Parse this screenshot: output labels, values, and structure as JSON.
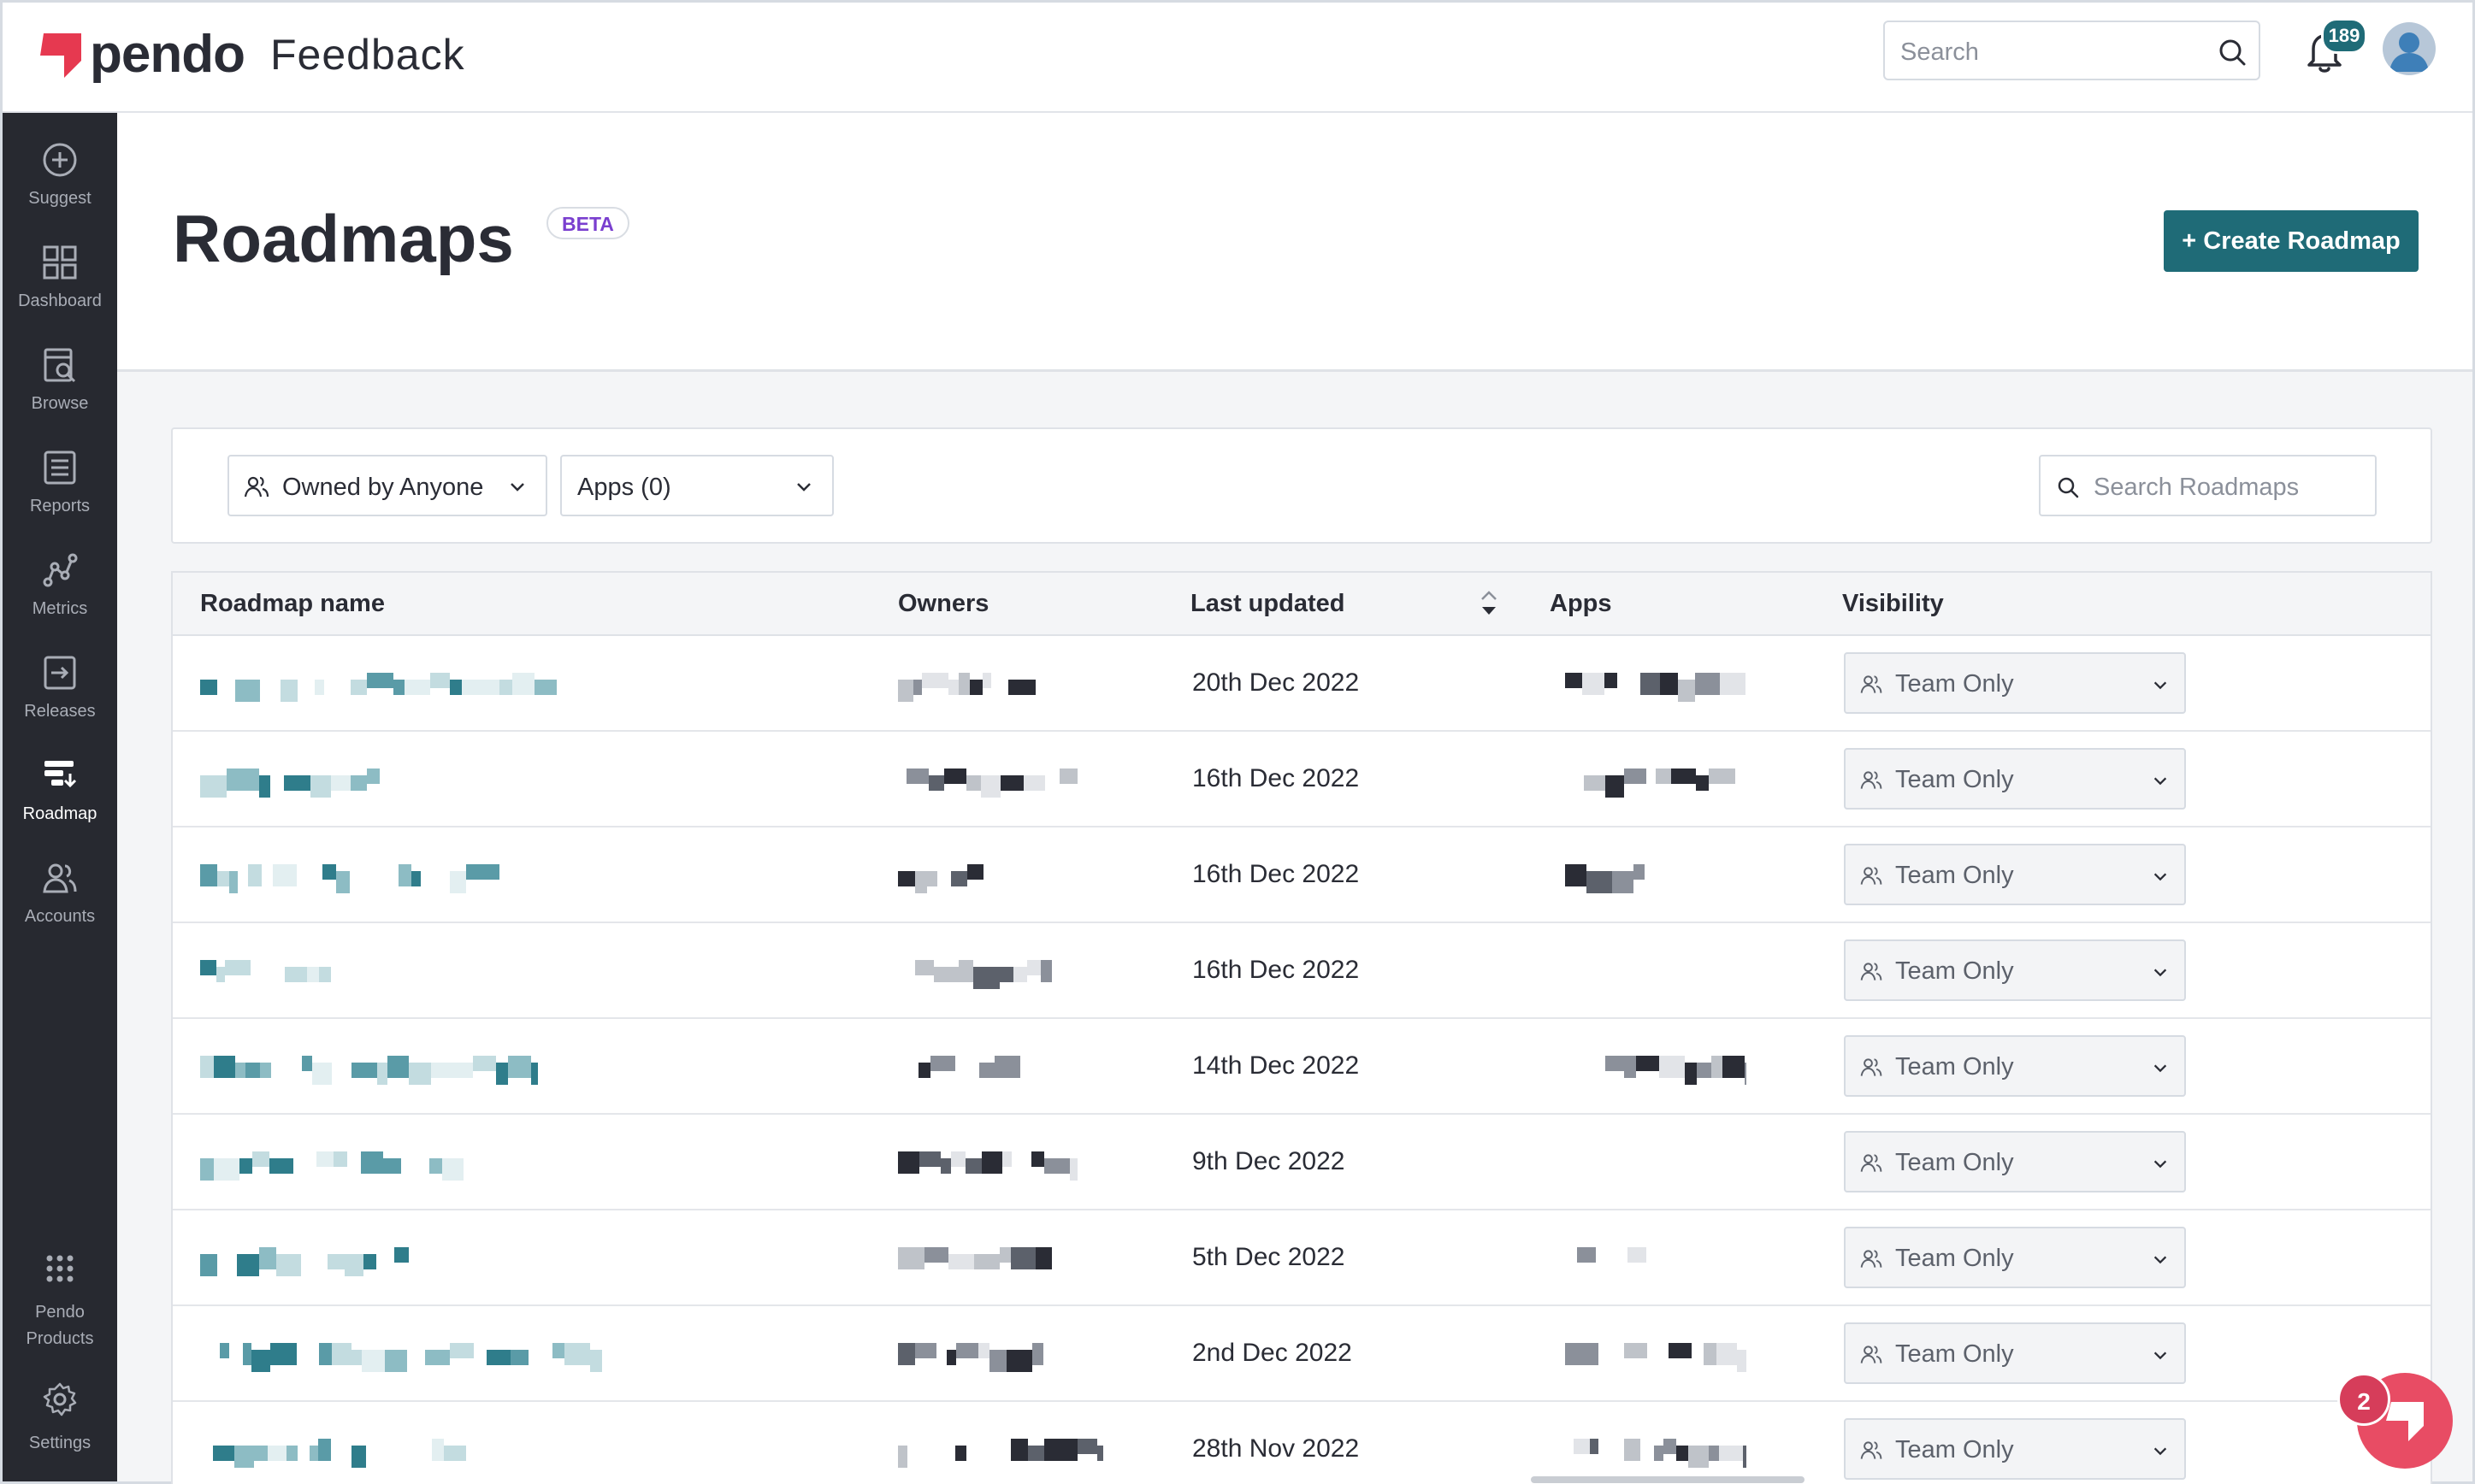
{
  "app": {
    "brand": "pendo",
    "product": "Feedback",
    "accent": "#1f6b77",
    "brand_red": "#e63950"
  },
  "header": {
    "search_placeholder": "Search",
    "notification_count": "189"
  },
  "sidebar": {
    "items": [
      {
        "label": "Suggest",
        "icon": "plus-circle-icon"
      },
      {
        "label": "Dashboard",
        "icon": "grid-icon"
      },
      {
        "label": "Browse",
        "icon": "browse-icon"
      },
      {
        "label": "Reports",
        "icon": "list-icon"
      },
      {
        "label": "Metrics",
        "icon": "metrics-icon"
      },
      {
        "label": "Releases",
        "icon": "releases-icon"
      },
      {
        "label": "Roadmap",
        "icon": "roadmap-icon",
        "active": true
      },
      {
        "label": "Accounts",
        "icon": "people-icon"
      }
    ],
    "bottom_items": [
      {
        "label_line1": "Pendo",
        "label_line2": "Products",
        "icon": "apps-dots-icon"
      },
      {
        "label": "Settings",
        "icon": "gear-icon"
      }
    ]
  },
  "page": {
    "title": "Roadmaps",
    "badge": "BETA",
    "create_button": "+ Create Roadmap"
  },
  "filters": {
    "owner": "Owned by Anyone",
    "apps": "Apps (0)",
    "search_placeholder": "Search Roadmaps"
  },
  "table": {
    "columns": [
      "Roadmap name",
      "Owners",
      "Last updated",
      "Apps",
      "Visibility"
    ],
    "rows": [
      {
        "last_updated": "20th Dec 2022",
        "visibility": "Team Only",
        "has_apps": true
      },
      {
        "last_updated": "16th Dec 2022",
        "visibility": "Team Only",
        "has_apps": true
      },
      {
        "last_updated": "16th Dec 2022",
        "visibility": "Team Only",
        "has_apps": true
      },
      {
        "last_updated": "16th Dec 2022",
        "visibility": "Team Only",
        "has_apps": false
      },
      {
        "last_updated": "14th Dec 2022",
        "visibility": "Team Only",
        "has_apps": true
      },
      {
        "last_updated": "9th Dec 2022",
        "visibility": "Team Only",
        "has_apps": false
      },
      {
        "last_updated": "5th Dec 2022",
        "visibility": "Team Only",
        "has_apps": true
      },
      {
        "last_updated": "2nd Dec 2022",
        "visibility": "Team Only",
        "has_apps": true
      },
      {
        "last_updated": "28th Nov 2022",
        "visibility": "Team Only",
        "has_apps": true
      }
    ]
  },
  "help": {
    "badge_count": "2"
  }
}
